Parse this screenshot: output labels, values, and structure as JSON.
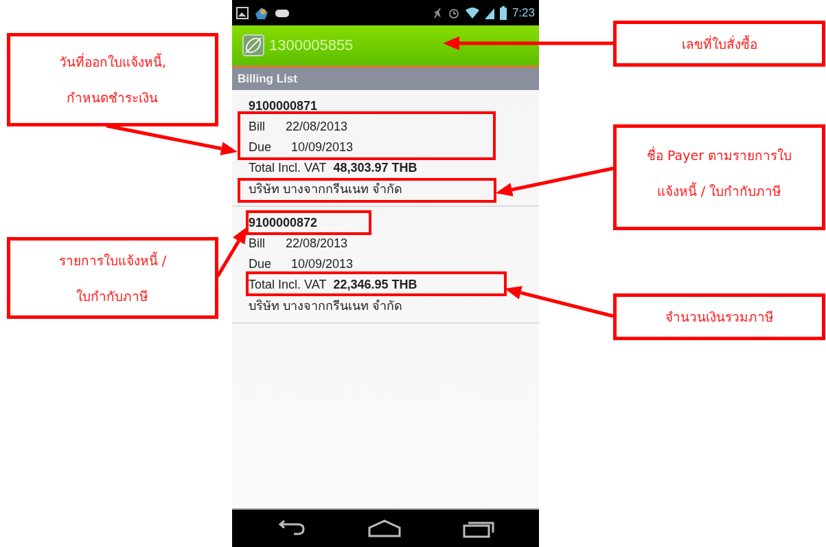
{
  "status_bar": {
    "time": "7:23"
  },
  "app_bar": {
    "title": "1300005855"
  },
  "section_header": "Billing List",
  "bills": [
    {
      "number": "9100000871",
      "bill_label": "Bill",
      "bill_date": "22/08/2013",
      "due_label": "Due",
      "due_date": "10/09/2013",
      "total_label": "Total Incl. VAT",
      "total": "48,303.97 THB",
      "payer": "บริษัท บางจากกรีนเนท จำกัด"
    },
    {
      "number": "9100000872",
      "bill_label": "Bill",
      "bill_date": "22/08/2013",
      "due_label": "Due",
      "due_date": "10/09/2013",
      "total_label": "Total Incl. VAT",
      "total": "22,346.95 THB",
      "payer": "บริษัท บางจากกรีนเนท จำกัด"
    }
  ],
  "callouts": [
    {
      "text": "วันที่ออกใบแจ้งหนี้,\nกำหนดชำระเงิน"
    },
    {
      "text": "รายการใบแจ้งหนี้ /\nใบกำกับภาษี"
    },
    {
      "text": "เลขที่ใบสั่งซื้อ"
    },
    {
      "text": "ชื่อ Payer ตามรายการใบ\nแจ้งหนี้ / ใบกำกับภาษี"
    },
    {
      "text": "จำนวนเงินรวมภาษี"
    }
  ]
}
